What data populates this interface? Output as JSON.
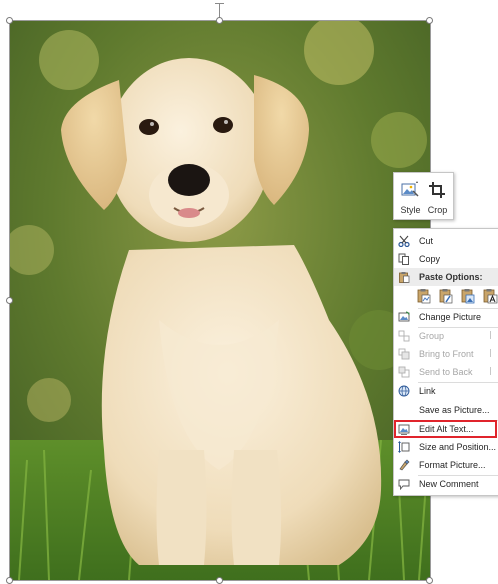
{
  "mini_toolbar": {
    "style_label": "Style",
    "crop_label": "Crop"
  },
  "menu": {
    "cut": "Cut",
    "copy": "Copy",
    "paste_options": "Paste Options:",
    "change_picture": "Change Picture",
    "group": "Group",
    "bring_to_front": "Bring to Front",
    "send_to_back": "Send to Back",
    "link": "Link",
    "save_as_picture": "Save as Picture...",
    "edit_alt_text": "Edit Alt Text...",
    "size_and_position": "Size and Position...",
    "format_picture": "Format Picture...",
    "new_comment": "New Comment"
  },
  "colors": {
    "highlight_border": "#e0242c",
    "disabled_text": "#a6a6a6"
  }
}
